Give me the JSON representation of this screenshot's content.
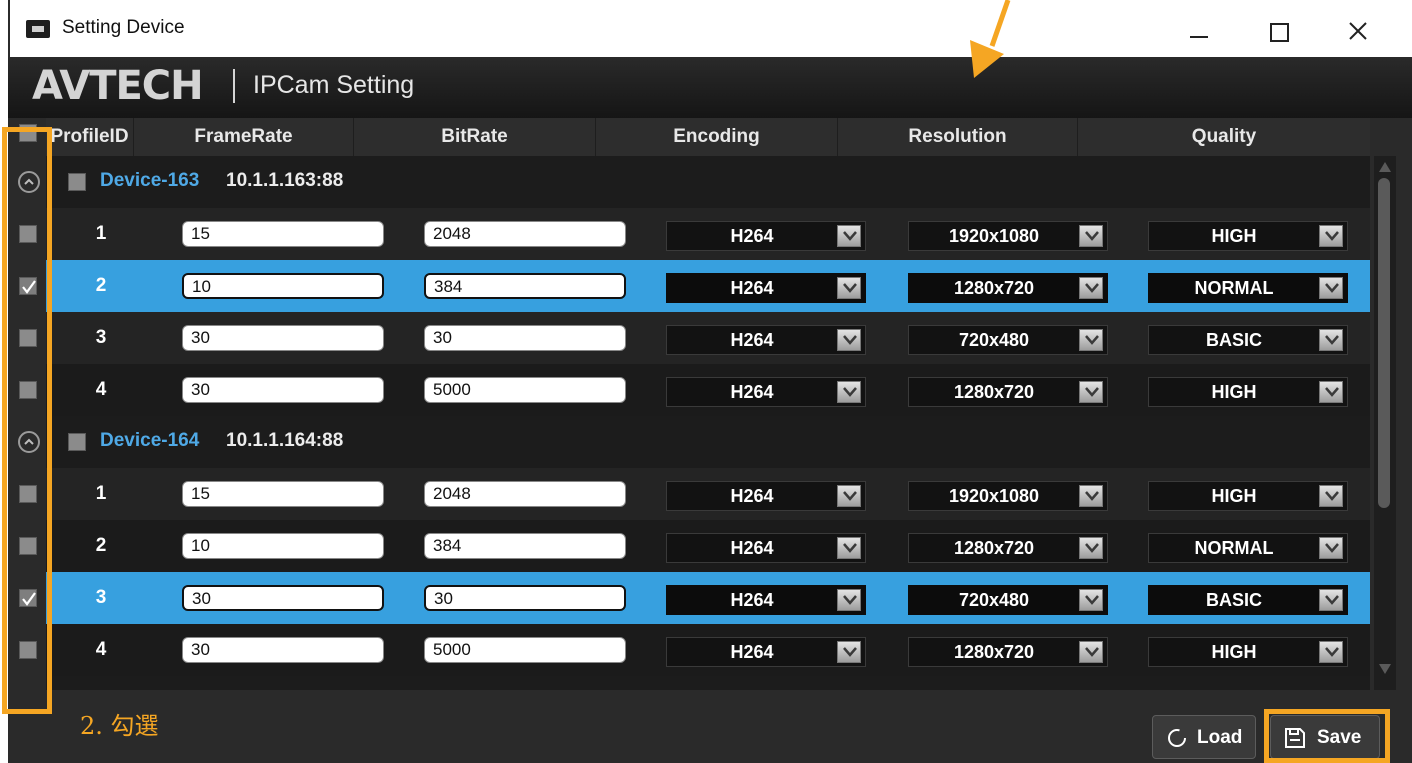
{
  "window": {
    "title": "Setting Device",
    "app_icon": "device-icon",
    "controls": [
      "minimize-icon",
      "maximize-icon",
      "close-icon"
    ]
  },
  "header": {
    "logo": "AVTECH",
    "app_title": "IPCam Setting"
  },
  "table": {
    "columns": [
      "ProfileID",
      "FrameRate",
      "BitRate",
      "Encoding",
      "Resolution",
      "Quality"
    ],
    "groups": [
      {
        "name": "Device-163",
        "address": "10.1.1.163:88",
        "rows": [
          {
            "id": "1",
            "framerate": "15",
            "bitrate": "2048",
            "encoding": "H264",
            "resolution": "1920x1080",
            "quality": "HIGH",
            "selected": false
          },
          {
            "id": "2",
            "framerate": "10",
            "bitrate": "384",
            "encoding": "H264",
            "resolution": "1280x720",
            "quality": "NORMAL",
            "selected": true
          },
          {
            "id": "3",
            "framerate": "30",
            "bitrate": "30",
            "encoding": "H264",
            "resolution": "720x480",
            "quality": "BASIC",
            "selected": false
          },
          {
            "id": "4",
            "framerate": "30",
            "bitrate": "5000",
            "encoding": "H264",
            "resolution": "1280x720",
            "quality": "HIGH",
            "selected": false
          }
        ]
      },
      {
        "name": "Device-164",
        "address": "10.1.1.164:88",
        "rows": [
          {
            "id": "1",
            "framerate": "15",
            "bitrate": "2048",
            "encoding": "H264",
            "resolution": "1920x1080",
            "quality": "HIGH",
            "selected": false
          },
          {
            "id": "2",
            "framerate": "10",
            "bitrate": "384",
            "encoding": "H264",
            "resolution": "1280x720",
            "quality": "NORMAL",
            "selected": false
          },
          {
            "id": "3",
            "framerate": "30",
            "bitrate": "30",
            "encoding": "H264",
            "resolution": "720x480",
            "quality": "BASIC",
            "selected": true
          },
          {
            "id": "4",
            "framerate": "30",
            "bitrate": "5000",
            "encoding": "H264",
            "resolution": "1280x720",
            "quality": "HIGH",
            "selected": false
          }
        ]
      }
    ]
  },
  "footer": {
    "annotation": "2. 勾選",
    "load_label": "Load",
    "save_label": "Save"
  },
  "colors": {
    "accent": "#37a0df",
    "device_name": "#4fa9e6",
    "annotation": "#f5a623",
    "background": "#1c1c1c"
  }
}
